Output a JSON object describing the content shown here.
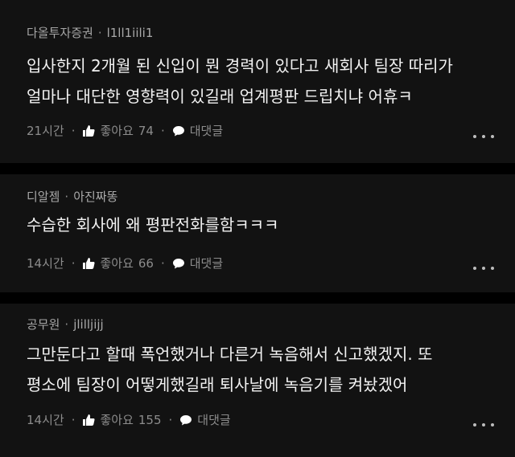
{
  "comments": [
    {
      "author": "다올투자증권",
      "nickname": "l1ll1iili1",
      "text_line1": "입사한지 2개월 된 신입이 뭔 경력이 있다고 새회사 팀장 따리가",
      "text_line2": "얼마나 대단한 영향력이 있길래 업계평판 드립치냐 어휴ㅋ",
      "time": "21시간",
      "like_label": "좋아요",
      "like_count": "74",
      "reply_label": "대댓글",
      "more_icon": "more-dots-icon"
    },
    {
      "author": "디알젬",
      "nickname": "아진짜똥",
      "text_line1": "수습한 회사에 왜 평판전화를함ㅋㅋㅋ",
      "text_line2": "",
      "time": "14시간",
      "like_label": "좋아요",
      "like_count": "66",
      "reply_label": "대댓글",
      "more_icon": "more-dots-icon"
    },
    {
      "author": "공무원",
      "nickname": "jlilljijj",
      "text_line1": "그만둔다고 할때 폭언했거나 다른거 녹음해서 신고했겠지. 또",
      "text_line2": "평소에 팀장이 어떻게했길래 퇴사날에 녹음기를 켜놨겠어",
      "time": "14시간",
      "like_label": "좋아요",
      "like_count": "155",
      "reply_label": "대댓글",
      "more_icon": "more-dots-icon"
    }
  ],
  "separator": "·"
}
